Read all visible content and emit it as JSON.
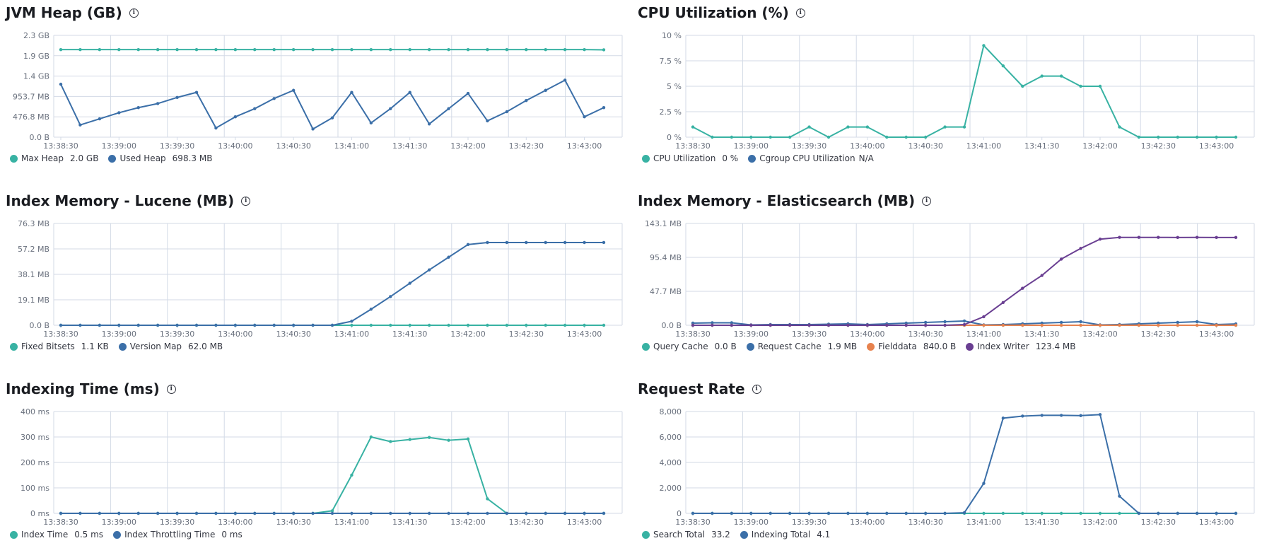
{
  "colors": {
    "teal": "#38b2a3",
    "blue": "#3b6fa8",
    "orange": "#e7824e",
    "purple": "#6a3f92",
    "grid": "#d3dae6",
    "tick": "#69707d",
    "info_icon": "info-icon"
  },
  "chart_data": [
    {
      "id": "jvm",
      "type": "line",
      "title": "JVM Heap (GB)",
      "yticks": [
        "0.0 B",
        "476.8 MB",
        "953.7 MB",
        "1.4 GB",
        "1.9 GB",
        "2.3 GB"
      ],
      "ymax": 5.0,
      "xticks": [
        "13:38:30",
        "13:39:00",
        "13:39:30",
        "13:40:00",
        "13:40:30",
        "13:41:00",
        "13:41:30",
        "13:42:00",
        "13:42:30",
        "13:43:00"
      ],
      "series": [
        {
          "name": "Max Heap",
          "legend_value": "2.0 GB",
          "color": "#38b2a3",
          "y": [
            4.3,
            4.3,
            4.3,
            4.3,
            4.3,
            4.3,
            4.3,
            4.3,
            4.3,
            4.3,
            4.3,
            4.3,
            4.3,
            4.3,
            4.3,
            4.3,
            4.3,
            4.3,
            4.3,
            4.3,
            4.3,
            4.3,
            4.3,
            4.3,
            4.3,
            4.3,
            4.3,
            4.3,
            4.29
          ]
        },
        {
          "name": "Used Heap",
          "legend_value": "698.3 MB",
          "color": "#3b6fa8",
          "y": [
            2.6,
            0.6,
            0.9,
            1.2,
            1.45,
            1.65,
            1.95,
            2.2,
            0.45,
            1.0,
            1.4,
            1.9,
            2.3,
            0.4,
            0.95,
            2.2,
            0.7,
            1.4,
            2.2,
            0.65,
            1.4,
            2.15,
            0.8,
            1.25,
            1.8,
            2.3,
            2.8,
            1.0,
            1.45
          ]
        }
      ]
    },
    {
      "id": "cpu",
      "type": "line",
      "title": "CPU Utilization (%)",
      "yticks": [
        "0 %",
        "2.5 %",
        "5 %",
        "7.5 %",
        "10 %"
      ],
      "ymax": 10,
      "xticks": [
        "13:38:30",
        "13:39:00",
        "13:39:30",
        "13:40:00",
        "13:40:30",
        "13:41:00",
        "13:41:30",
        "13:42:00",
        "13:42:30",
        "13:43:00"
      ],
      "series": [
        {
          "name": "CPU Utilization",
          "legend_value": "0 %",
          "color": "#38b2a3",
          "y": [
            1,
            0,
            0,
            0,
            0,
            0,
            1,
            0,
            1,
            1,
            0,
            0,
            0,
            1,
            1,
            9,
            7,
            5,
            6,
            6,
            5,
            5,
            1,
            0,
            0,
            0,
            0,
            0,
            0
          ]
        },
        {
          "name": "Cgroup CPU Utilization",
          "legend_value": "N/A",
          "color": "#3b6fa8",
          "y": []
        }
      ]
    },
    {
      "id": "lucene",
      "type": "line",
      "title": "Index Memory - Lucene (MB)",
      "yticks": [
        "0.0 B",
        "19.1 MB",
        "38.1 MB",
        "57.2 MB",
        "76.3 MB"
      ],
      "ymax": 76.3,
      "xticks": [
        "13:38:30",
        "13:39:00",
        "13:39:30",
        "13:40:00",
        "13:40:30",
        "13:41:00",
        "13:41:30",
        "13:42:00",
        "13:42:30",
        "13:43:00"
      ],
      "series": [
        {
          "name": "Fixed Bitsets",
          "legend_value": "1.1 KB",
          "color": "#38b2a3",
          "y": [
            0,
            0,
            0,
            0,
            0,
            0,
            0,
            0,
            0,
            0,
            0,
            0,
            0,
            0,
            0,
            0,
            0,
            0,
            0,
            0,
            0,
            0,
            0,
            0,
            0,
            0,
            0,
            0,
            0
          ]
        },
        {
          "name": "Version Map",
          "legend_value": "62.0 MB",
          "color": "#3b6fa8",
          "y": [
            0,
            0,
            0,
            0,
            0,
            0,
            0,
            0,
            0,
            0,
            0,
            0,
            0,
            0,
            0,
            3,
            12,
            21.5,
            31.5,
            41.5,
            51,
            60.5,
            62,
            62,
            62,
            62,
            62,
            62,
            62
          ]
        }
      ]
    },
    {
      "id": "es",
      "type": "line",
      "title": "Index Memory - Elasticsearch (MB)",
      "yticks": [
        "0.0 B",
        "47.7 MB",
        "95.4 MB",
        "143.1 MB"
      ],
      "ymax": 143.1,
      "xticks": [
        "13:38:30",
        "13:39:00",
        "13:39:30",
        "13:40:00",
        "13:40:30",
        "13:41:00",
        "13:41:30",
        "13:42:00",
        "13:42:30",
        "13:43:00"
      ],
      "series": [
        {
          "name": "Query Cache",
          "legend_value": "0.0 B",
          "color": "#38b2a3",
          "y": [
            0,
            0,
            0,
            0,
            0,
            0,
            0,
            0,
            0,
            0,
            0,
            0,
            0,
            0,
            0,
            0,
            0,
            0,
            0,
            0,
            0,
            0,
            0,
            0,
            0,
            0,
            0,
            0,
            0
          ]
        },
        {
          "name": "Request Cache",
          "legend_value": "1.9 MB",
          "color": "#3b6fa8",
          "y": [
            3,
            3.5,
            3.5,
            0.5,
            1,
            1,
            1,
            1.5,
            2,
            1,
            2,
            3,
            4,
            5,
            6,
            0.5,
            1,
            2,
            3,
            4,
            5,
            0.5,
            1,
            2,
            3,
            4,
            5,
            1,
            1.9
          ]
        },
        {
          "name": "Fielddata",
          "legend_value": "840.0 B",
          "color": "#e7824e",
          "y": [
            0,
            0,
            0,
            0,
            0,
            0,
            0,
            0,
            0,
            0,
            0,
            0,
            0,
            0,
            0,
            0,
            0,
            0,
            0,
            0,
            0,
            0,
            0,
            0,
            0,
            0,
            0,
            0,
            0
          ]
        },
        {
          "name": "Index Writer",
          "legend_value": "123.4 MB",
          "color": "#6a3f92",
          "y": [
            0,
            0,
            0,
            0,
            0,
            0,
            0,
            0,
            0,
            0,
            0,
            0,
            0,
            0,
            1,
            12,
            32,
            52,
            70,
            93,
            108,
            121,
            123.5,
            123.5,
            123.5,
            123.4,
            123.5,
            123.4,
            123.4
          ]
        }
      ]
    },
    {
      "id": "idxtime",
      "type": "line",
      "title": "Indexing Time (ms)",
      "yticks": [
        "0 ms",
        "100 ms",
        "200 ms",
        "300 ms",
        "400 ms"
      ],
      "ymax": 400,
      "xticks": [
        "13:38:30",
        "13:39:00",
        "13:39:30",
        "13:40:00",
        "13:40:30",
        "13:41:00",
        "13:41:30",
        "13:42:00",
        "13:42:30",
        "13:43:00"
      ],
      "series": [
        {
          "name": "Index Time",
          "legend_value": "0.5 ms",
          "color": "#38b2a3",
          "y": [
            0,
            0,
            0,
            0,
            0,
            0,
            0,
            0,
            0,
            0,
            0,
            0,
            0,
            0,
            10,
            150,
            300,
            282,
            290,
            298,
            287,
            292,
            57,
            0,
            0,
            0,
            0,
            0,
            0
          ]
        },
        {
          "name": "Index Throttling Time",
          "legend_value": "0 ms",
          "color": "#3b6fa8",
          "y": [
            0,
            0,
            0,
            0,
            0,
            0,
            0,
            0,
            0,
            0,
            0,
            0,
            0,
            0,
            0,
            0,
            0,
            0,
            0,
            0,
            0,
            0,
            0,
            0,
            0,
            0,
            0,
            0,
            0
          ]
        }
      ]
    },
    {
      "id": "reqrate",
      "type": "line",
      "title": "Request Rate",
      "yticks": [
        "0",
        "2,000",
        "4,000",
        "6,000",
        "8,000"
      ],
      "ymax": 8000,
      "xticks": [
        "13:38:30",
        "13:39:00",
        "13:39:30",
        "13:40:00",
        "13:40:30",
        "13:41:00",
        "13:41:30",
        "13:42:00",
        "13:42:30",
        "13:43:00"
      ],
      "series": [
        {
          "name": "Search Total",
          "legend_value": "33.2",
          "color": "#38b2a3",
          "y": [
            0,
            0,
            0,
            0,
            0,
            0,
            0,
            0,
            0,
            0,
            0,
            0,
            0,
            0,
            0,
            0,
            0,
            0,
            0,
            0,
            0,
            0,
            0,
            0,
            0,
            0,
            0,
            0,
            0
          ]
        },
        {
          "name": "Indexing Total",
          "legend_value": "4.1",
          "color": "#3b6fa8",
          "y": [
            0,
            0,
            0,
            0,
            0,
            0,
            0,
            0,
            0,
            0,
            0,
            0,
            0,
            0,
            50,
            2350,
            7480,
            7640,
            7700,
            7700,
            7680,
            7760,
            1350,
            0,
            0,
            0,
            0,
            0,
            0
          ]
        }
      ]
    }
  ]
}
